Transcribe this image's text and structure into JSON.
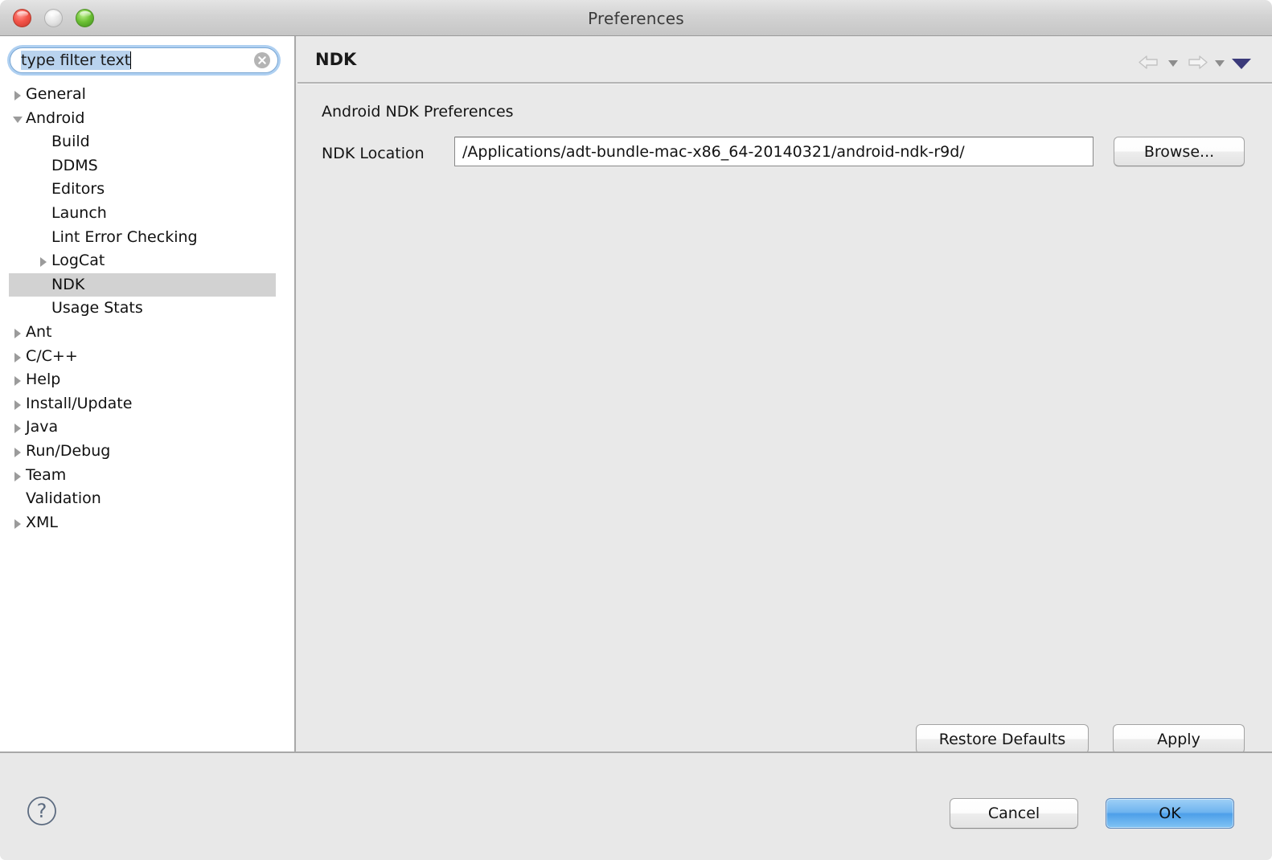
{
  "window": {
    "title": "Preferences",
    "traffic_lights": [
      {
        "name": "close",
        "color": "#f4554a"
      },
      {
        "name": "minimize",
        "color": "#e2e2e2"
      },
      {
        "name": "zoom",
        "color": "#6cc034"
      }
    ]
  },
  "sidebar": {
    "filter": {
      "value": "type filter text",
      "placeholder": "type filter text",
      "clear_icon": "clear-circle-icon",
      "selected": true
    },
    "tree": [
      {
        "label": "General",
        "indent": 0,
        "twisty": "collapsed",
        "selected": false
      },
      {
        "label": "Android",
        "indent": 0,
        "twisty": "expanded",
        "selected": false
      },
      {
        "label": "Build",
        "indent": 1,
        "twisty": "none",
        "selected": false
      },
      {
        "label": "DDMS",
        "indent": 1,
        "twisty": "none",
        "selected": false
      },
      {
        "label": "Editors",
        "indent": 1,
        "twisty": "none",
        "selected": false
      },
      {
        "label": "Launch",
        "indent": 1,
        "twisty": "none",
        "selected": false
      },
      {
        "label": "Lint Error Checking",
        "indent": 1,
        "twisty": "none",
        "selected": false
      },
      {
        "label": "LogCat",
        "indent": 1,
        "twisty": "collapsed",
        "selected": false
      },
      {
        "label": "NDK",
        "indent": 1,
        "twisty": "none",
        "selected": true
      },
      {
        "label": "Usage Stats",
        "indent": 1,
        "twisty": "none",
        "selected": false
      },
      {
        "label": "Ant",
        "indent": 0,
        "twisty": "collapsed",
        "selected": false
      },
      {
        "label": "C/C++",
        "indent": 0,
        "twisty": "collapsed",
        "selected": false
      },
      {
        "label": "Help",
        "indent": 0,
        "twisty": "collapsed",
        "selected": false
      },
      {
        "label": "Install/Update",
        "indent": 0,
        "twisty": "collapsed",
        "selected": false
      },
      {
        "label": "Java",
        "indent": 0,
        "twisty": "collapsed",
        "selected": false
      },
      {
        "label": "Run/Debug",
        "indent": 0,
        "twisty": "collapsed",
        "selected": false
      },
      {
        "label": "Team",
        "indent": 0,
        "twisty": "collapsed",
        "selected": false
      },
      {
        "label": "Validation",
        "indent": 0,
        "twisty": "none",
        "selected": false
      },
      {
        "label": "XML",
        "indent": 0,
        "twisty": "collapsed",
        "selected": false
      }
    ]
  },
  "panel": {
    "title": "NDK",
    "subtitle": "Android NDK Preferences",
    "nav": {
      "back_icon": "arrow-left-icon",
      "back_dropdown_icon": "caret-down-icon",
      "forward_icon": "arrow-right-icon",
      "forward_dropdown_icon": "caret-down-icon",
      "menu_icon": "triangle-down-icon",
      "menu_icon_color": "#3b3a7a",
      "back_enabled": false,
      "forward_enabled": false
    },
    "ndk_location": {
      "label": "NDK Location",
      "value": "/Applications/adt-bundle-mac-x86_64-20140321/android-ndk-r9d/",
      "browse_label": "Browse..."
    },
    "restore_defaults_label": "Restore Defaults",
    "apply_label": "Apply"
  },
  "bottom_bar": {
    "help_icon": "question-circle-icon",
    "cancel_label": "Cancel",
    "ok_label": "OK",
    "default_button": "OK"
  },
  "colors": {
    "selection": "#d2d2d2",
    "panel_background": "#e9e9e9",
    "sidebar_background": "#ffffff",
    "focus_ring": "#6eaae6",
    "default_button_blue": "#4d9fe9"
  }
}
